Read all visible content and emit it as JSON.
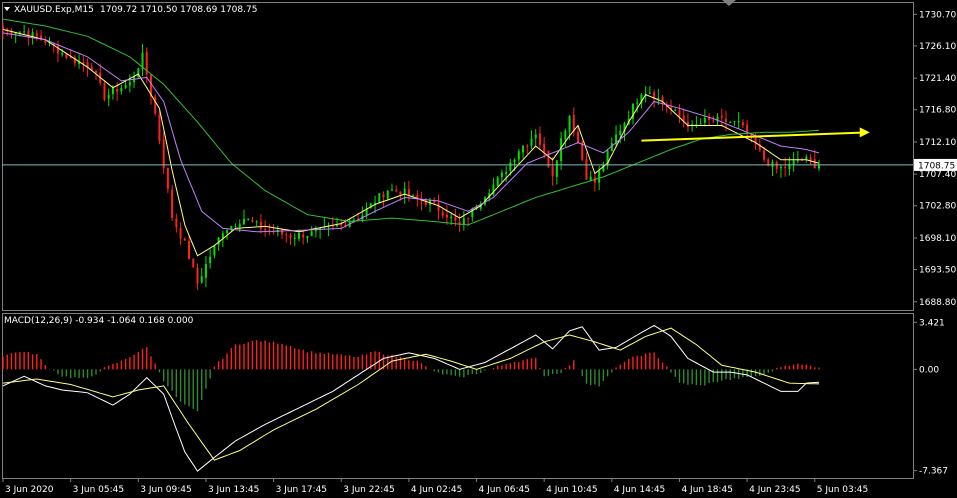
{
  "window": {
    "symbol_label": "XAUUSD.Exp,M15",
    "ohlc_label": "1709.72 1710.50 1708.69 1708.75"
  },
  "colors": {
    "background": "#000000",
    "bull_candle": "#00e000",
    "bear_candle": "#ff2020",
    "ma_fast": "#ffff80",
    "ma_medium": "#c080ff",
    "ma_slow": "#30c030",
    "current_price_line": "#7fbfbf",
    "annotation_arrow": "#ffff00",
    "axis_line": "#808080",
    "price_tag_bg": "#ffffff",
    "price_tag_text": "#000000",
    "macd_line": "#ffffff",
    "signal_line": "#ffff80",
    "hist_positive": "#ff2020",
    "hist_negative": "#2e8b2e"
  },
  "chart_data": [
    {
      "type": "candlestick",
      "panel": "price",
      "ylim": [
        1687.6,
        1732.5
      ],
      "y_ticks": [
        "1730.70",
        "1726.10",
        "1721.40",
        "1716.80",
        "1712.10",
        "1707.40",
        "1702.80",
        "1698.10",
        "1693.50",
        "1688.80"
      ],
      "current_price": "1708.75",
      "path": [
        [
          0,
          1728.5
        ],
        [
          5,
          1728.2
        ],
        [
          10,
          1726.8
        ],
        [
          16,
          1724.2
        ],
        [
          21,
          1723.1
        ],
        [
          24,
          1718.7
        ],
        [
          27,
          1719.8
        ],
        [
          30,
          1720.6
        ],
        [
          33,
          1724.5
        ],
        [
          34,
          1722.0
        ],
        [
          36,
          1716.2
        ],
        [
          40,
          1701.2
        ],
        [
          43,
          1697.2
        ],
        [
          46,
          1691.5
        ],
        [
          49,
          1695.5
        ],
        [
          52,
          1699.2
        ],
        [
          57,
          1701.0
        ],
        [
          62,
          1699.3
        ],
        [
          68,
          1698.4
        ],
        [
          74,
          1698.8
        ],
        [
          80,
          1700.0
        ],
        [
          85,
          1701.5
        ],
        [
          88,
          1703.5
        ],
        [
          91,
          1705.2
        ],
        [
          95,
          1704.7
        ],
        [
          98,
          1703.6
        ],
        [
          101,
          1703.2
        ],
        [
          105,
          1701.5
        ],
        [
          108,
          1699.8
        ],
        [
          111,
          1702.0
        ],
        [
          114,
          1704.5
        ],
        [
          118,
          1707.2
        ],
        [
          122,
          1711.0
        ],
        [
          124,
          1712.0
        ],
        [
          126,
          1713.5
        ],
        [
          128,
          1710.3
        ],
        [
          130,
          1707.5
        ],
        [
          132,
          1712.5
        ],
        [
          134,
          1716.0
        ],
        [
          136,
          1712.0
        ],
        [
          138,
          1707.2
        ],
        [
          140,
          1706.2
        ],
        [
          142,
          1709.0
        ],
        [
          145,
          1713.0
        ],
        [
          148,
          1716.0
        ],
        [
          151,
          1719.5
        ],
        [
          153,
          1719.5
        ],
        [
          156,
          1717.8
        ],
        [
          160,
          1715.8
        ],
        [
          163,
          1714.2
        ],
        [
          166,
          1715.1
        ],
        [
          170,
          1715.2
        ],
        [
          174,
          1714.8
        ],
        [
          177,
          1712.5
        ],
        [
          180,
          1709.6
        ],
        [
          183,
          1708.1
        ],
        [
          186,
          1708.6
        ],
        [
          188,
          1709.5
        ],
        [
          190,
          1709.5
        ],
        [
          192,
          1708.8
        ],
        [
          193,
          1708.75
        ]
      ],
      "overlays": [
        {
          "name": "ma_fast",
          "color_key": "ma_fast",
          "points": [
            [
              0,
              1728.5
            ],
            [
              10,
              1727.0
            ],
            [
              20,
              1723.0
            ],
            [
              26,
              1720.0
            ],
            [
              32,
              1722.0
            ],
            [
              37,
              1717.0
            ],
            [
              40,
              1708.0
            ],
            [
              43,
              1700.0
            ],
            [
              46,
              1695.5
            ],
            [
              50,
              1697.0
            ],
            [
              55,
              1699.5
            ],
            [
              62,
              1699.8
            ],
            [
              70,
              1699.0
            ],
            [
              80,
              1700.2
            ],
            [
              88,
              1703.0
            ],
            [
              95,
              1704.5
            ],
            [
              103,
              1702.8
            ],
            [
              108,
              1701.0
            ],
            [
              113,
              1702.8
            ],
            [
              120,
              1707.5
            ],
            [
              126,
              1711.5
            ],
            [
              130,
              1709.5
            ],
            [
              134,
              1713.0
            ],
            [
              136,
              1714.5
            ],
            [
              140,
              1707.5
            ],
            [
              143,
              1709.0
            ],
            [
              148,
              1715.0
            ],
            [
              152,
              1719.0
            ],
            [
              156,
              1718.0
            ],
            [
              162,
              1714.5
            ],
            [
              170,
              1714.5
            ],
            [
              178,
              1712.0
            ],
            [
              184,
              1709.5
            ],
            [
              190,
              1709.5
            ],
            [
              193,
              1709.0
            ]
          ]
        },
        {
          "name": "ma_medium",
          "color_key": "ma_medium",
          "points": [
            [
              0,
              1728.0
            ],
            [
              10,
              1727.0
            ],
            [
              20,
              1724.5
            ],
            [
              28,
              1721.0
            ],
            [
              34,
              1721.5
            ],
            [
              38,
              1718.0
            ],
            [
              42,
              1709.5
            ],
            [
              47,
              1702.0
            ],
            [
              52,
              1699.5
            ],
            [
              60,
              1699.0
            ],
            [
              70,
              1699.2
            ],
            [
              80,
              1699.5
            ],
            [
              88,
              1702.0
            ],
            [
              95,
              1704.0
            ],
            [
              103,
              1703.5
            ],
            [
              110,
              1702.0
            ],
            [
              116,
              1704.0
            ],
            [
              124,
              1709.0
            ],
            [
              130,
              1710.5
            ],
            [
              136,
              1712.0
            ],
            [
              142,
              1710.5
            ],
            [
              148,
              1713.5
            ],
            [
              154,
              1718.0
            ],
            [
              160,
              1717.0
            ],
            [
              168,
              1715.5
            ],
            [
              176,
              1713.5
            ],
            [
              184,
              1711.5
            ],
            [
              190,
              1711.0
            ],
            [
              193,
              1710.5
            ]
          ]
        },
        {
          "name": "ma_slow",
          "color_key": "ma_slow",
          "points": [
            [
              0,
              1730.0
            ],
            [
              10,
              1729.0
            ],
            [
              20,
              1727.5
            ],
            [
              30,
              1724.5
            ],
            [
              38,
              1720.5
            ],
            [
              46,
              1715.0
            ],
            [
              54,
              1709.0
            ],
            [
              62,
              1705.0
            ],
            [
              72,
              1701.5
            ],
            [
              82,
              1700.5
            ],
            [
              92,
              1701.0
            ],
            [
              102,
              1700.5
            ],
            [
              110,
              1700.0
            ],
            [
              118,
              1702.0
            ],
            [
              126,
              1704.0
            ],
            [
              134,
              1705.5
            ],
            [
              142,
              1707.0
            ],
            [
              150,
              1709.0
            ],
            [
              158,
              1711.0
            ],
            [
              165,
              1712.5
            ],
            [
              172,
              1713.2
            ],
            [
              180,
              1713.5
            ],
            [
              186,
              1713.5
            ],
            [
              193,
              1713.8
            ]
          ]
        }
      ],
      "annotations": [
        {
          "type": "arrow",
          "color_key": "annotation_arrow",
          "from": [
            151,
            1712.3
          ],
          "to": [
            205,
            1713.5
          ]
        }
      ]
    },
    {
      "type": "macd",
      "panel": "indicator",
      "label": "MACD(12,26,9) -0.934 -1.064 0.168 0.000",
      "ylim": [
        -7.9,
        4.1
      ],
      "y_ticks": [
        "3.421",
        "0.00",
        "-7.367"
      ],
      "macd": [
        [
          0,
          -1.2
        ],
        [
          5,
          -0.5
        ],
        [
          10,
          -1.2
        ],
        [
          14,
          -1.5
        ],
        [
          20,
          -1.7
        ],
        [
          26,
          -2.6
        ],
        [
          30,
          -1.8
        ],
        [
          34,
          -0.6
        ],
        [
          38,
          -1.8
        ],
        [
          40,
          -3.5
        ],
        [
          43,
          -6.0
        ],
        [
          46,
          -7.4
        ],
        [
          50,
          -6.4
        ],
        [
          55,
          -5.2
        ],
        [
          62,
          -4.0
        ],
        [
          70,
          -2.8
        ],
        [
          78,
          -1.6
        ],
        [
          85,
          -0.2
        ],
        [
          90,
          0.8
        ],
        [
          96,
          1.2
        ],
        [
          102,
          0.8
        ],
        [
          108,
          0.0
        ],
        [
          114,
          0.5
        ],
        [
          120,
          1.5
        ],
        [
          126,
          2.5
        ],
        [
          130,
          1.5
        ],
        [
          134,
          2.8
        ],
        [
          137,
          3.1
        ],
        [
          141,
          1.4
        ],
        [
          145,
          1.6
        ],
        [
          150,
          2.5
        ],
        [
          154,
          3.2
        ],
        [
          158,
          2.4
        ],
        [
          162,
          0.8
        ],
        [
          168,
          -0.2
        ],
        [
          172,
          -0.2
        ],
        [
          176,
          -0.4
        ],
        [
          180,
          -1.0
        ],
        [
          184,
          -1.6
        ],
        [
          188,
          -1.6
        ],
        [
          190,
          -1.0
        ],
        [
          193,
          -0.93
        ]
      ],
      "signal": [
        [
          0,
          -1.0
        ],
        [
          8,
          -0.7
        ],
        [
          16,
          -1.1
        ],
        [
          26,
          -2.0
        ],
        [
          32,
          -1.5
        ],
        [
          38,
          -1.2
        ],
        [
          44,
          -4.0
        ],
        [
          50,
          -6.6
        ],
        [
          56,
          -5.9
        ],
        [
          64,
          -4.4
        ],
        [
          74,
          -2.9
        ],
        [
          84,
          -1.1
        ],
        [
          92,
          0.6
        ],
        [
          100,
          1.1
        ],
        [
          106,
          0.6
        ],
        [
          112,
          0.0
        ],
        [
          120,
          0.8
        ],
        [
          128,
          2.0
        ],
        [
          134,
          2.5
        ],
        [
          140,
          2.0
        ],
        [
          146,
          1.4
        ],
        [
          152,
          2.4
        ],
        [
          158,
          3.0
        ],
        [
          164,
          1.8
        ],
        [
          170,
          0.3
        ],
        [
          178,
          -0.2
        ],
        [
          186,
          -1.0
        ],
        [
          193,
          -1.06
        ]
      ],
      "histogram": [
        [
          0,
          1.0
        ],
        [
          4,
          1.3
        ],
        [
          8,
          1.1
        ],
        [
          10,
          0.3
        ],
        [
          14,
          -0.5
        ],
        [
          20,
          -0.7
        ],
        [
          24,
          0.1
        ],
        [
          28,
          0.6
        ],
        [
          31,
          1.1
        ],
        [
          34,
          1.6
        ],
        [
          38,
          -0.8
        ],
        [
          42,
          -2.4
        ],
        [
          46,
          -3.1
        ],
        [
          50,
          0.2
        ],
        [
          55,
          1.8
        ],
        [
          60,
          2.1
        ],
        [
          66,
          1.9
        ],
        [
          72,
          1.3
        ],
        [
          78,
          1.1
        ],
        [
          84,
          0.9
        ],
        [
          88,
          1.3
        ],
        [
          92,
          1.0
        ],
        [
          98,
          0.6
        ],
        [
          102,
          -0.2
        ],
        [
          108,
          -0.6
        ],
        [
          112,
          -0.3
        ],
        [
          116,
          0.1
        ],
        [
          120,
          0.5
        ],
        [
          126,
          0.8
        ],
        [
          128,
          -0.5
        ],
        [
          132,
          -0.2
        ],
        [
          135,
          0.6
        ],
        [
          138,
          -1.0
        ],
        [
          141,
          -1.2
        ],
        [
          146,
          0.4
        ],
        [
          150,
          1.0
        ],
        [
          154,
          1.2
        ],
        [
          157,
          0.2
        ],
        [
          160,
          -1.0
        ],
        [
          165,
          -1.2
        ],
        [
          170,
          -0.8
        ],
        [
          176,
          -0.6
        ],
        [
          180,
          -0.4
        ],
        [
          184,
          0.2
        ],
        [
          187,
          0.4
        ],
        [
          190,
          0.3
        ],
        [
          193,
          0.17
        ]
      ]
    }
  ],
  "x_axis": {
    "labels": [
      "3 Jun 2020",
      "3 Jun 05:45",
      "3 Jun 09:45",
      "3 Jun 13:45",
      "3 Jun 17:45",
      "3 Jun 22:45",
      "4 Jun 02:45",
      "4 Jun 06:45",
      "4 Jun 10:45",
      "4 Jun 14:45",
      "4 Jun 18:45",
      "4 Jun 23:45",
      "5 Jun 03:45"
    ]
  }
}
